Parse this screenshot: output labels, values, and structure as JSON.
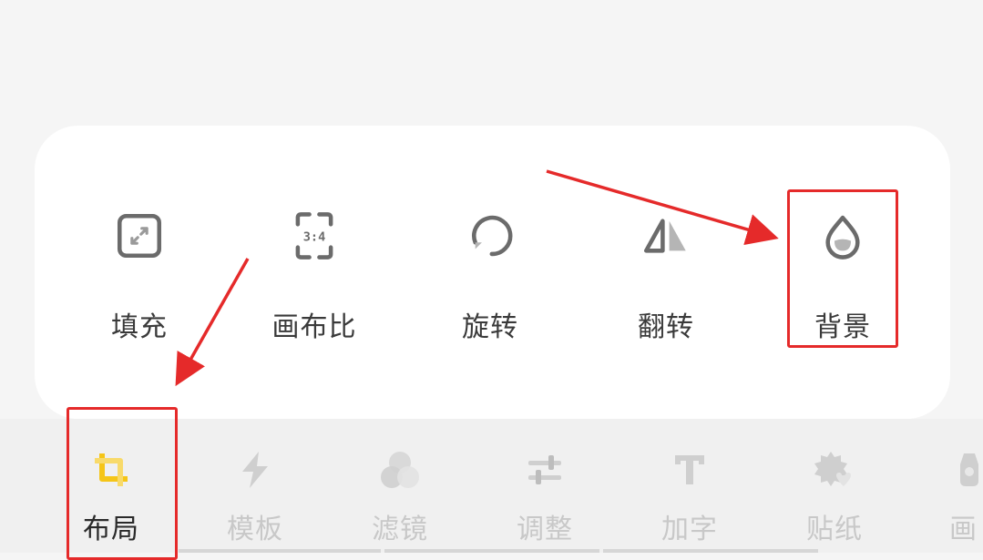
{
  "toolbar": {
    "items": [
      {
        "label": "填充",
        "icon": "fill-expand-icon"
      },
      {
        "label": "画布比",
        "icon": "canvas-ratio-icon",
        "badge": "3:4"
      },
      {
        "label": "旋转",
        "icon": "rotate-icon"
      },
      {
        "label": "翻转",
        "icon": "flip-icon"
      },
      {
        "label": "背景",
        "icon": "background-drop-icon"
      }
    ]
  },
  "tabs": {
    "items": [
      {
        "label": "布局",
        "icon": "crop-icon",
        "active": true
      },
      {
        "label": "模板",
        "icon": "lightning-icon"
      },
      {
        "label": "滤镜",
        "icon": "filter-circles-icon"
      },
      {
        "label": "调整",
        "icon": "adjust-sliders-icon"
      },
      {
        "label": "加字",
        "icon": "text-T-icon"
      },
      {
        "label": "贴纸",
        "icon": "sticker-icon"
      },
      {
        "label": "画",
        "icon": "paint-icon"
      }
    ]
  },
  "colors": {
    "accent_active": "#f5c518",
    "annotation_red": "#e52a2a",
    "icon_gray": "#6b6b6b",
    "icon_inactive": "#cfcfcf"
  }
}
